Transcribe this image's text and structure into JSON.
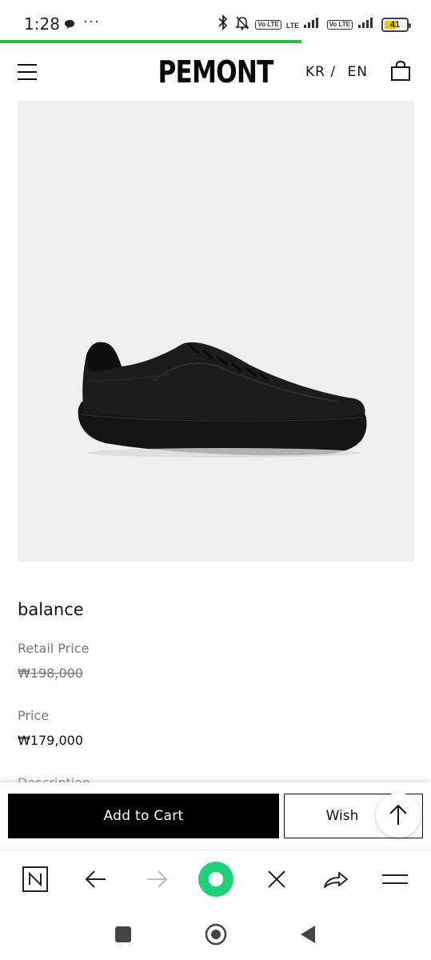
{
  "status_bar": {
    "time": "1:28",
    "dots": "···",
    "lte": "LTE",
    "volte": "Vo LTE",
    "battery": "41",
    "battery_color": "#f2c200"
  },
  "page_load_progress": 0.7,
  "header": {
    "logo": "PEMONT",
    "lang_kr": "KR /",
    "lang_en": "EN",
    "menu_icon": "hamburger-menu-icon",
    "cart_icon": "shopping-bag-icon"
  },
  "product": {
    "name": "balance",
    "retail_label": "Retail Price",
    "retail_price": "₩198,000",
    "price_label": "Price",
    "price": "₩179,000",
    "description_label": "Description",
    "image_bg": "#efefef"
  },
  "actions": {
    "add_to_cart": "Add to Cart",
    "wish": "Wish",
    "scroll_top_icon": "arrow-up-icon"
  },
  "browser_toolbar": {
    "icons": [
      "naver-n-icon",
      "back-arrow-icon",
      "forward-arrow-icon",
      "green-circle-icon",
      "close-icon",
      "share-icon",
      "menu-icon"
    ],
    "accent": "#20d17a"
  },
  "nav_bar": {
    "icons": [
      "recents-square-icon",
      "home-circle-icon",
      "back-triangle-icon"
    ]
  }
}
